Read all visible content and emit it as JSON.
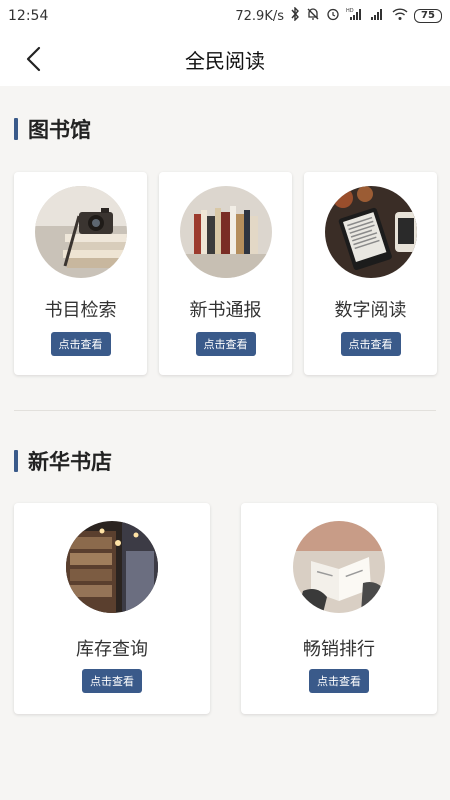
{
  "status": {
    "time": "12:54",
    "speed": "72.9K/s",
    "battery": "75",
    "hd_label": "HD"
  },
  "header": {
    "title": "全民阅读"
  },
  "sections": [
    {
      "title": "图书馆",
      "cards": [
        {
          "label": "书目检索",
          "button": "点击查看",
          "image": "camera-books"
        },
        {
          "label": "新书通报",
          "button": "点击查看",
          "image": "book-row"
        },
        {
          "label": "数字阅读",
          "button": "点击查看",
          "image": "ereader"
        }
      ]
    },
    {
      "title": "新华书店",
      "cards": [
        {
          "label": "库存查询",
          "button": "点击查看",
          "image": "bookstore-shelves"
        },
        {
          "label": "畅销排行",
          "button": "点击查看",
          "image": "open-book"
        }
      ]
    }
  ],
  "colors": {
    "accent": "#3a5a8a",
    "background": "#f6f5f3"
  }
}
